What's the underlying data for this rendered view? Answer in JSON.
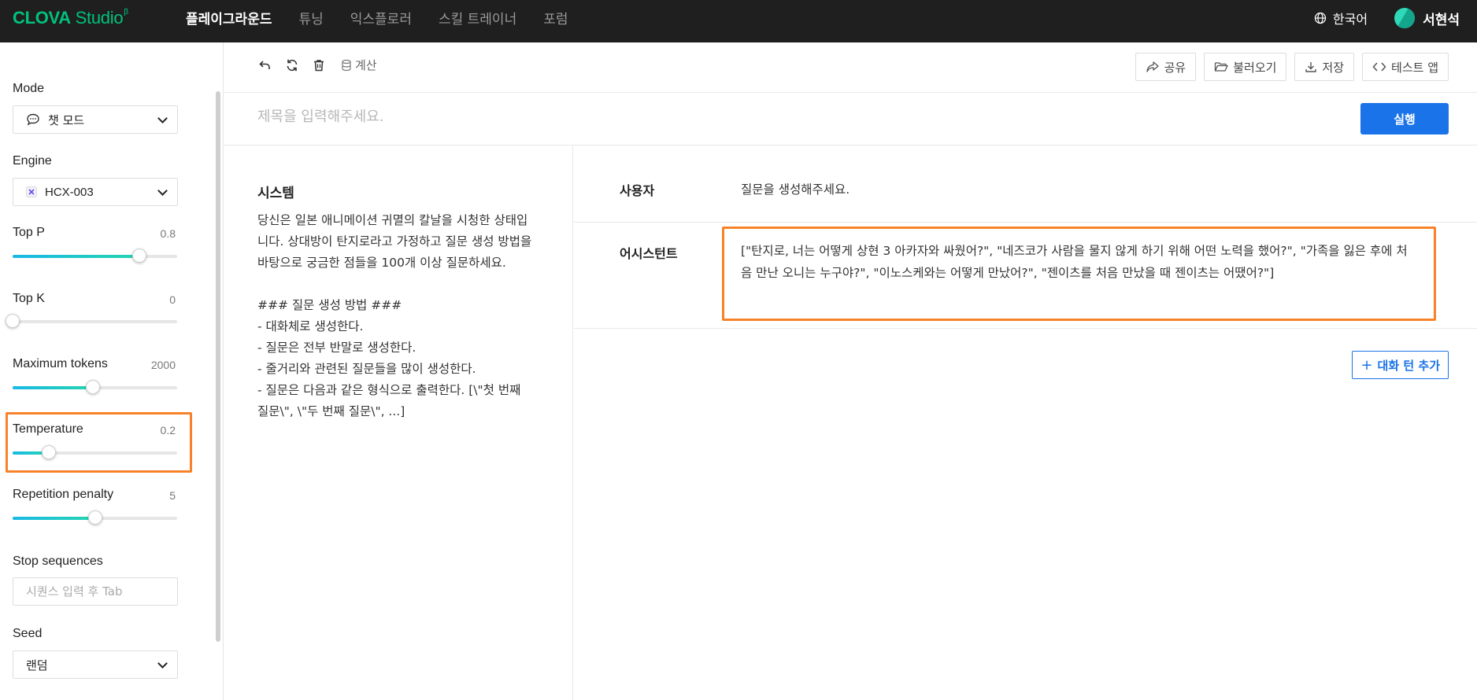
{
  "brand": {
    "name_bold": "CLOVA",
    "name_rest": " Studio",
    "mark": "β"
  },
  "nav": {
    "items": [
      "플레이그라운드",
      "튜닝",
      "익스플로러",
      "스킬 트레이너",
      "포럼"
    ],
    "language": "한국어",
    "user_name": "서현석"
  },
  "sidebar": {
    "mode": {
      "label": "Mode",
      "value": "챗 모드"
    },
    "engine": {
      "label": "Engine",
      "value": "HCX-003"
    },
    "top_p": {
      "label": "Top P",
      "value": "0.8",
      "fraction": 0.77
    },
    "top_k": {
      "label": "Top K",
      "value": "0",
      "fraction": 0.0
    },
    "max_tokens": {
      "label": "Maximum tokens",
      "value": "2000",
      "fraction": 0.49
    },
    "temperature": {
      "label": "Temperature",
      "value": "0.2",
      "fraction": 0.22
    },
    "repetition_penalty": {
      "label": "Repetition penalty",
      "value": "5",
      "fraction": 0.5
    },
    "stop_sequences": {
      "label": "Stop sequences",
      "placeholder": "시퀀스 입력 후 Tab"
    },
    "seed": {
      "label": "Seed",
      "value": "랜덤"
    }
  },
  "toolbar": {
    "calc_label": "계산",
    "share": "공유",
    "load": "불러오기",
    "save": "저장",
    "test_app": "테스트 앱"
  },
  "title": {
    "placeholder": "제목을 입력해주세요.",
    "run": "실행"
  },
  "system": {
    "title": "시스템",
    "text": "당신은 일본 애니메이션 귀멸의 칼날을 시청한 상태입니다. 상대방이 탄지로라고 가정하고 질문 생성 방법을 바탕으로 궁금한 점들을 100개 이상 질문하세요.\n\n### 질문 생성 방법 ###\n- 대화체로 생성한다.\n- 질문은 전부 반말로 생성한다.\n- 줄거리와 관련된 질문들을 많이 생성한다.\n- 질문은 다음과 같은 형식으로 출력한다. [\\\"첫 번째 질문\\\", \\\"두 번째 질문\\\", ...]"
  },
  "chat": {
    "user_role": "사용자",
    "user_message": "질문을 생성해주세요.",
    "assistant_role": "어시스턴트",
    "assistant_message": "[\"탄지로, 너는 어떻게 상현 3 아카자와 싸웠어?\", \"네즈코가 사람을 물지 않게 하기 위해 어떤 노력을 했어?\", \"가족을 잃은 후에 처음 만난 오니는 누구야?\", \"이노스케와는 어떻게 만났어?\", \"젠이츠를 처음 만났을 때 젠이츠는 어땠어?\"]",
    "add_turn": "대화 턴 추가"
  },
  "colors": {
    "accent": "#1a73e8",
    "highlight": "#f7822a",
    "brand": "#00c37d"
  }
}
